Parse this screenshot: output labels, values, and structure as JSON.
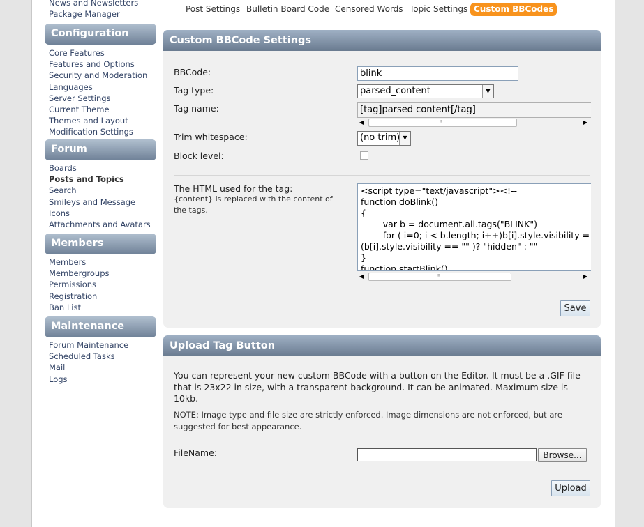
{
  "sidebar": {
    "top_links": [
      "News and Newsletters",
      "Package Manager"
    ],
    "sections": [
      {
        "title": "Configuration",
        "links": [
          "Core Features",
          "Features and Options",
          "Security and Moderation",
          "Languages",
          "Server Settings",
          "Current Theme",
          "Themes and Layout",
          "Modification Settings"
        ]
      },
      {
        "title": "Forum",
        "links": [
          "Boards",
          "Posts and Topics",
          "Search",
          "Smileys and Message",
          "Icons",
          "Attachments and Avatars"
        ]
      },
      {
        "title": "Members",
        "links": [
          "Members",
          "Membergroups",
          "Permissions",
          "Registration",
          "Ban List"
        ]
      },
      {
        "title": "Maintenance",
        "links": [
          "Forum Maintenance",
          "Scheduled Tasks",
          "Mail",
          "Logs"
        ]
      }
    ]
  },
  "tabs": [
    "Post Settings",
    "Bulletin Board Code",
    "Censored Words",
    "Topic Settings",
    "Custom BBCodes"
  ],
  "settings": {
    "title": "Custom BBCode Settings",
    "bbcode_label": "BBCode:",
    "bbcode_value": "blink",
    "tag_type_label": "Tag type:",
    "tag_type_value": "parsed_content",
    "tag_name_label": "Tag name:",
    "tag_name_value": "[tag]parsed content[/tag]",
    "trim_label": "Trim whitespace:",
    "trim_value": "(no trim)",
    "block_label": "Block level:",
    "html_label": "The HTML used for the tag:",
    "html_note": "{content} is replaced with the content of the tags.",
    "html_code": "<script type=\"text/javascript\"><!--\nfunction doBlink()\n{\n        var b = document.all.tags(\"BLINK\")\n        for ( i=0; i < b.length; i++)b[i].style.visibility =\n(b[i].style.visibility == \"\" )? \"hidden\" : \"\"\n}\nfunction startBlink()",
    "save_label": "Save"
  },
  "upload": {
    "title": "Upload Tag Button",
    "description": "You can represent your new custom BBCode with a button on the Editor. It must be a .GIF file that is 23x22 in size, with a transparent background. It can be animated. Maximum size is 10kb.",
    "note": "NOTE: Image type and file size are strictly enforced. Image dimensions are not enforced, but are suggested for best appearance.",
    "filename_label": "FileName:",
    "filename_value": "",
    "browse_label": "Browse...",
    "upload_label": "Upload"
  }
}
